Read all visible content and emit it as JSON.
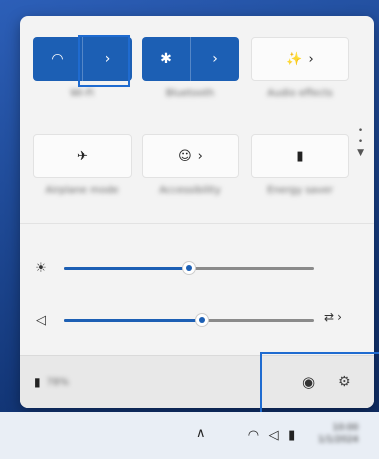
{
  "tiles": [
    {
      "id": "wifi",
      "label": "Wi-Fi",
      "icon": "wifi-icon",
      "glyph": "◠",
      "arrow": "›",
      "state": "on"
    },
    {
      "id": "bluetooth",
      "label": "Bluetooth",
      "icon": "bluetooth-icon",
      "glyph": "✱",
      "arrow": "›",
      "state": "on"
    },
    {
      "id": "audio",
      "label": "Audio effects",
      "icon": "sparkle-window-icon",
      "glyph": "✨",
      "arrow": "›",
      "state": "off"
    },
    {
      "id": "airplane",
      "label": "Airplane mode",
      "icon": "airplane-icon",
      "glyph": "✈",
      "state": "off"
    },
    {
      "id": "accessibility",
      "label": "Accessibility",
      "icon": "accessibility-icon",
      "glyph": "☺",
      "arrow": "›",
      "state": "off"
    },
    {
      "id": "energy",
      "label": "Energy saver",
      "icon": "battery-leaf-icon",
      "glyph": "▮",
      "state": "off"
    }
  ],
  "sliders": {
    "brightness": {
      "icon": "brightness-icon",
      "glyph": "☀",
      "value": 0.5
    },
    "volume": {
      "icon": "volume-icon",
      "glyph": "◁",
      "value": 0.55,
      "right_glyph": "⇄",
      "right_arrow": "›"
    }
  },
  "footer": {
    "battery_glyph": "▮",
    "battery_text": "78%",
    "center_glyph": "◉",
    "settings_glyph": "⚙"
  },
  "scroll": {
    "dots": "•\n•",
    "down": "▼"
  },
  "taskbar": {
    "chevron": "∧",
    "wifi": "◠",
    "volume": "◁",
    "battery": "▮",
    "time": "10:00",
    "date": "1/1/2024"
  },
  "colors": {
    "accent": "#1c5fb4",
    "highlight": "#1f6bd0"
  }
}
